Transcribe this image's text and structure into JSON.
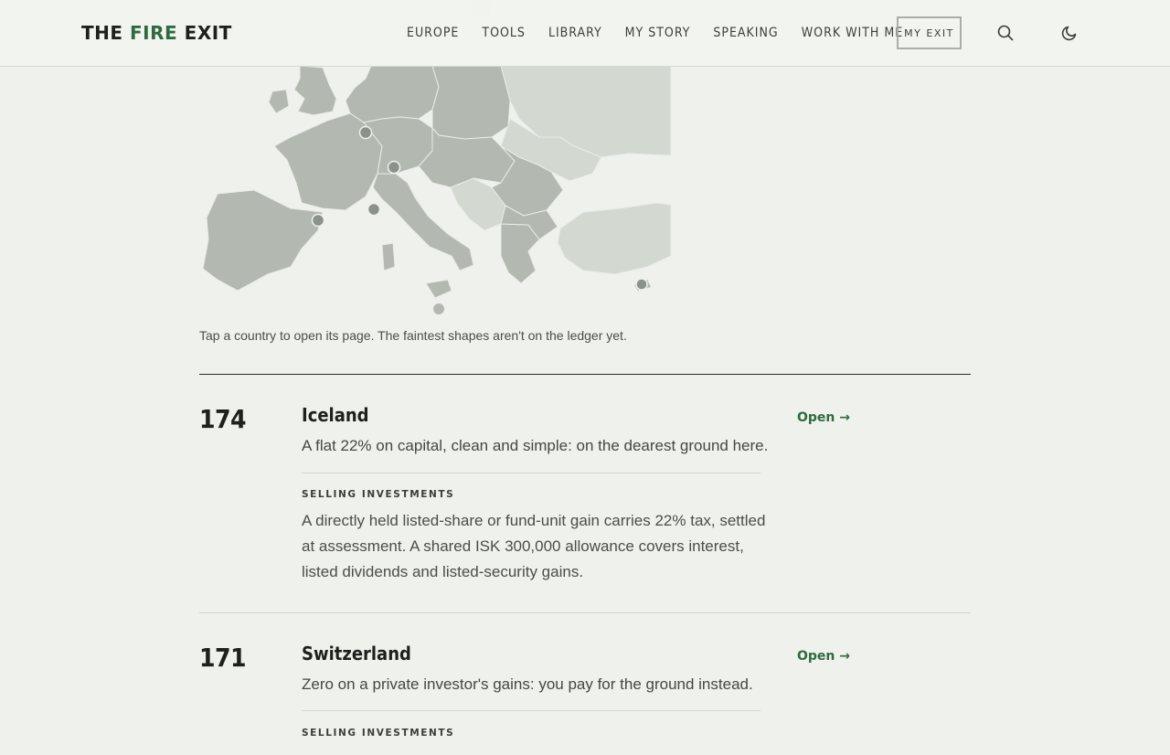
{
  "header": {
    "logo_pre": "THE ",
    "logo_accent": "FIRE",
    "logo_post": " EXIT",
    "nav": [
      "EUROPE",
      "TOOLS",
      "LIBRARY",
      "MY STORY",
      "SPEAKING",
      "WORK WITH ME"
    ],
    "exit_label": "MY EXIT",
    "search_icon": "search-icon",
    "theme_icon": "moon-icon"
  },
  "map": {
    "caption": "Tap a country to open its page. The faintest shapes aren't on the ledger yet."
  },
  "entries": [
    {
      "number": "174",
      "country": "Iceland",
      "summary": "A flat 22% on capital, clean and simple: on the dearest ground here.",
      "open_label": "Open →",
      "section_label": "SELLING INVESTMENTS",
      "body": "A directly held listed-share or fund-unit gain carries 22% tax, settled at assessment. A shared ISK 300,000 allowance covers interest, listed dividends and listed-security gains."
    },
    {
      "number": "171",
      "country": "Switzerland",
      "summary": "Zero on a private investor's gains: you pay for the ground instead.",
      "open_label": "Open →",
      "section_label": "SELLING INVESTMENTS",
      "body": ""
    }
  ],
  "colors": {
    "background": "#eef1ec",
    "accent": "#2f6b3f",
    "map_dark": "#b3b9b0",
    "map_light": "#d3d9d1"
  }
}
